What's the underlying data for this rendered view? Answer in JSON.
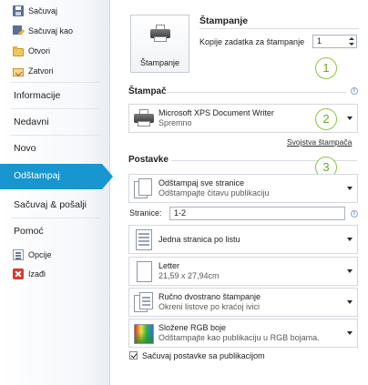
{
  "sidebar": {
    "top_items": [
      {
        "label": "Sačuvaj",
        "icon": "save-icon"
      },
      {
        "label": "Sačuvaj kao",
        "icon": "save-as-icon"
      },
      {
        "label": "Otvori",
        "icon": "open-folder-icon"
      },
      {
        "label": "Zatvori",
        "icon": "close-folder-icon"
      }
    ],
    "nav": [
      "Informacije",
      "Nedavni",
      "Novo",
      "Odštampaj",
      "Sačuvaj & pošalji",
      "Pomoć"
    ],
    "active": "Odštampaj",
    "bottom_items": [
      {
        "label": "Opcije",
        "icon": "options-icon"
      },
      {
        "label": "Izađi",
        "icon": "exit-icon"
      }
    ],
    "accent": "#1796d0"
  },
  "print": {
    "title": "Štampanje",
    "button_label": "Štampanje",
    "copies_label": "Kopije zadatka za štampanje",
    "copies_value": "1"
  },
  "printer": {
    "section_title": "Štampač",
    "name": "Microsoft XPS Document Writer",
    "status": "Spremno",
    "properties_link": "Svojstva štampača"
  },
  "settings": {
    "section_title": "Postavke",
    "print_what": {
      "title": "Odštampaj sve stranice",
      "subtitle": "Odštampajte čitavu publikaciju"
    },
    "pages_label": "Stranice:",
    "pages_value": "1-2",
    "layout": {
      "title": "Jedna stranica po listu"
    },
    "paper": {
      "title": "Letter",
      "subtitle": "21,59 x 27,94cm"
    },
    "duplex": {
      "title": "Ručno dvostrano štampanje",
      "subtitle": "Okreni listove po kraćoj ivici"
    },
    "color": {
      "title": "Složene RGB boje",
      "subtitle": "Odštampajte kao publikaciju u RGB bojama."
    },
    "save_checkbox": {
      "label": "Sačuvaj postavke sa publikacijom",
      "checked": true
    }
  },
  "callouts": [
    "1",
    "2",
    "3"
  ],
  "info_glyph": "i",
  "callout_color": "#8cc63f"
}
